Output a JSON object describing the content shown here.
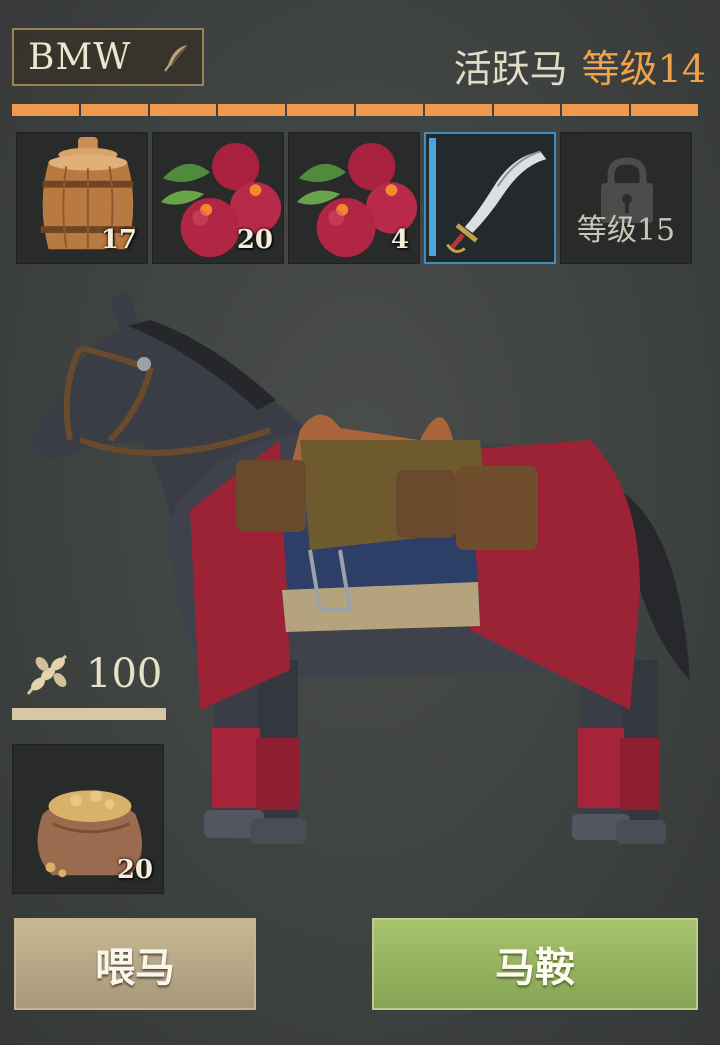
{
  "header": {
    "horse_name": "BMW",
    "horse_type": "活跃马",
    "level_label": "等级14"
  },
  "stamina": {
    "segments": 10,
    "filled": 10
  },
  "inventory": [
    {
      "item": "barrel-icon",
      "count": "17"
    },
    {
      "item": "berries-icon",
      "count": "20"
    },
    {
      "item": "berries-icon",
      "count": "4"
    },
    {
      "item": "sabre-icon",
      "selected": true
    },
    {
      "item": "lock-icon",
      "locked_label": "等级15"
    }
  ],
  "forage": {
    "icon": "wheat-icon",
    "value": "100"
  },
  "feed_slot": {
    "item": "grain-sack-icon",
    "count": "20"
  },
  "buttons": {
    "feed": "喂马",
    "saddle": "马鞍"
  },
  "colors": {
    "accent_orange": "#ee9a4c",
    "selected_blue": "#47a6da",
    "saddle_green": "#98b55f",
    "feed_tan": "#b8a886"
  }
}
